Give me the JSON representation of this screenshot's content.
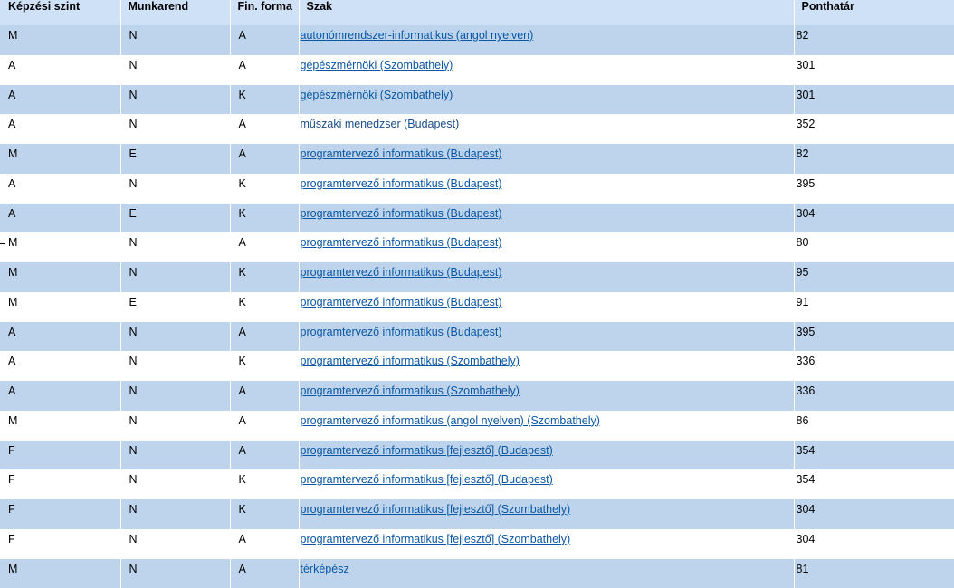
{
  "table": {
    "headers": [
      "Képzési szint",
      "Munkarend",
      "Fin. forma",
      "Szak",
      "Ponthatár"
    ],
    "rows": [
      {
        "szint": "M",
        "munkarend": "N",
        "fin": "A",
        "szak": "autonómrendszer-informatikus (angol nyelven)",
        "link": true,
        "pont": "82"
      },
      {
        "szint": "A",
        "munkarend": "N",
        "fin": "A",
        "szak": "gépészmérnöki (Szombathely)",
        "link": true,
        "pont": "301"
      },
      {
        "szint": "A",
        "munkarend": "N",
        "fin": "K",
        "szak": "gépészmérnöki (Szombathely)",
        "link": true,
        "pont": "301"
      },
      {
        "szint": "A",
        "munkarend": "N",
        "fin": "A",
        "szak": "műszaki menedzser (Budapest)",
        "link": false,
        "pont": "352"
      },
      {
        "szint": "M",
        "munkarend": "E",
        "fin": "A",
        "szak": "programtervező informatikus (Budapest)",
        "link": true,
        "pont": "82"
      },
      {
        "szint": "A",
        "munkarend": "N",
        "fin": "K",
        "szak": "programtervező informatikus (Budapest)",
        "link": true,
        "pont": "395"
      },
      {
        "szint": "A",
        "munkarend": "E",
        "fin": "K",
        "szak": "programtervező informatikus (Budapest)",
        "link": true,
        "pont": "304"
      },
      {
        "szint": "M",
        "munkarend": "N",
        "fin": "A",
        "szak": "programtervező informatikus (Budapest)",
        "link": true,
        "pont": "80"
      },
      {
        "szint": "M",
        "munkarend": "N",
        "fin": "K",
        "szak": "programtervező informatikus (Budapest)",
        "link": true,
        "pont": "95"
      },
      {
        "szint": "M",
        "munkarend": "E",
        "fin": "K",
        "szak": "programtervező informatikus (Budapest)",
        "link": true,
        "pont": "91"
      },
      {
        "szint": "A",
        "munkarend": "N",
        "fin": "A",
        "szak": "programtervező informatikus (Budapest)",
        "link": true,
        "pont": "395"
      },
      {
        "szint": "A",
        "munkarend": "N",
        "fin": "K",
        "szak": "programtervező informatikus (Szombathely)",
        "link": true,
        "pont": "336"
      },
      {
        "szint": "A",
        "munkarend": "N",
        "fin": "A",
        "szak": "programtervező informatikus (Szombathely)",
        "link": true,
        "pont": "336"
      },
      {
        "szint": "M",
        "munkarend": "N",
        "fin": "A",
        "szak": "programtervező informatikus (angol nyelven) (Szombathely)",
        "link": true,
        "pont": "86"
      },
      {
        "szint": "F",
        "munkarend": "N",
        "fin": "A",
        "szak": "programtervező informatikus [fejlesztő] (Budapest)",
        "link": true,
        "pont": "354"
      },
      {
        "szint": "F",
        "munkarend": "N",
        "fin": "K",
        "szak": "programtervező informatikus [fejlesztő] (Budapest)",
        "link": true,
        "pont": "354"
      },
      {
        "szint": "F",
        "munkarend": "N",
        "fin": "K",
        "szak": "programtervező informatikus [fejlesztő] (Szombathely)",
        "link": true,
        "pont": "304"
      },
      {
        "szint": "F",
        "munkarend": "N",
        "fin": "A",
        "szak": "programtervező informatikus [fejlesztő] (Szombathely)",
        "link": true,
        "pont": "304"
      },
      {
        "szint": "M",
        "munkarend": "N",
        "fin": "A",
        "szak": "térképész",
        "link": true,
        "pont": "81"
      }
    ]
  },
  "colors": {
    "header_bg": "#cfe1f7",
    "band_bg": "#bdd4ec",
    "plain_bg": "#ffffff",
    "link": "#0b57a4"
  }
}
